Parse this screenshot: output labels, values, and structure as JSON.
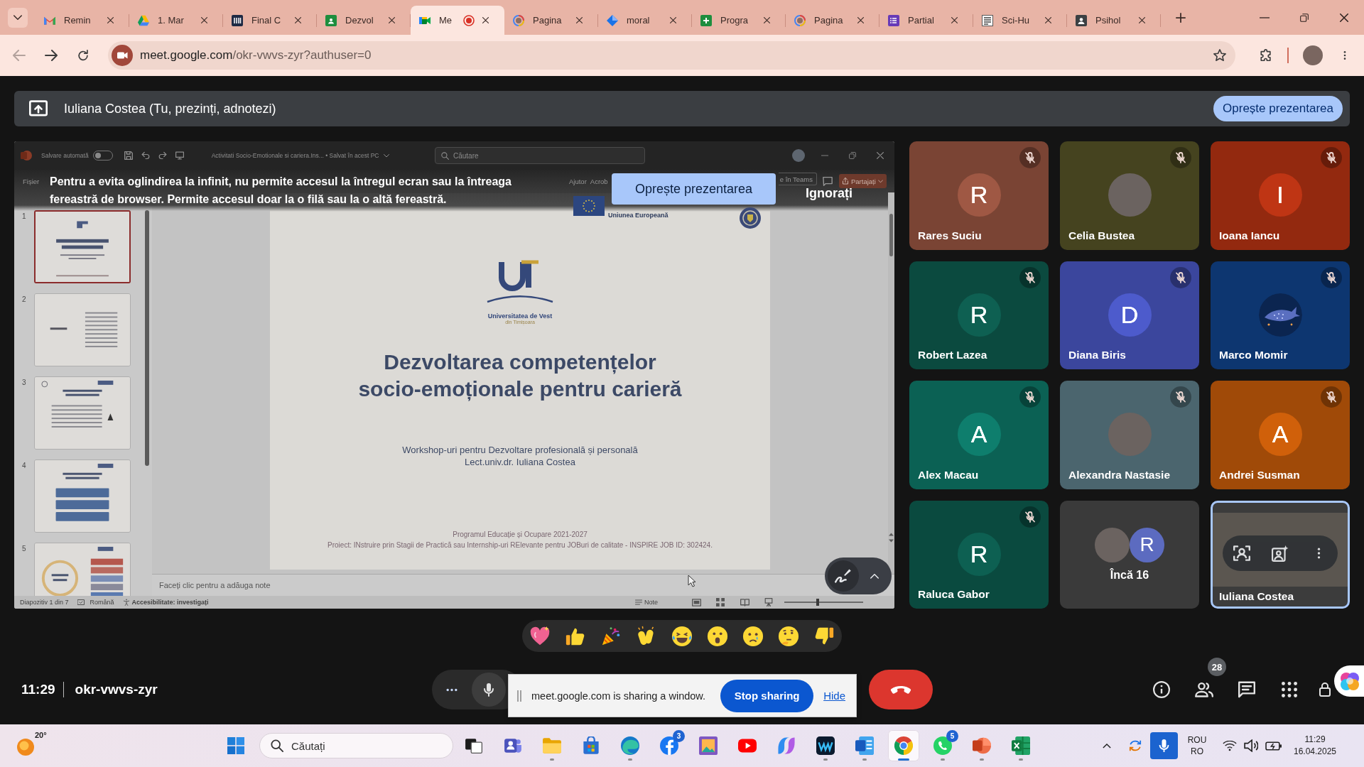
{
  "browser": {
    "tabs": [
      {
        "label": "Remin",
        "kind": "envelope",
        "selected": false,
        "recording": false
      },
      {
        "label": "1. Mar",
        "kind": "triangle",
        "selected": false,
        "recording": false
      },
      {
        "label": "Final C",
        "kind": "bars",
        "selected": false,
        "recording": false
      },
      {
        "label": "Dezvol",
        "kind": "person_board",
        "selected": false,
        "recording": false
      },
      {
        "label": "Me",
        "kind": "camera",
        "selected": true,
        "recording": true
      },
      {
        "label": "Pagina",
        "kind": "ring",
        "selected": false,
        "recording": false
      },
      {
        "label": "moral",
        "kind": "diamond",
        "selected": false,
        "recording": false
      },
      {
        "label": "Progra",
        "kind": "plus_square",
        "selected": false,
        "recording": false
      },
      {
        "label": "Pagina",
        "kind": "ring",
        "selected": false,
        "recording": false
      },
      {
        "label": "Partial",
        "kind": "list",
        "selected": false,
        "recording": false
      },
      {
        "label": "Sci-Hu",
        "kind": "document",
        "selected": false,
        "recording": false
      },
      {
        "label": "Psihol",
        "kind": "person_card",
        "selected": false,
        "recording": false
      }
    ],
    "back": {
      "disabled": true
    },
    "forward": {
      "disabled": false
    },
    "address": {
      "host": "meet.google.com",
      "path": "/okr-vwvs-zyr?authuser=0"
    }
  },
  "presenting_bar": {
    "label": "Iuliana Costea (Tu, prezinți, adnotezi)",
    "stop_button": "Oprește prezentarea"
  },
  "shared_window": {
    "warning": "Pentru a evita oglindirea la infinit, nu permite accesul la întregul ecran sau la întreaga fereastră de browser. Permite accesul doar la o filă sau la o altă fereastră.",
    "stop_button": "Oprește prezentarea",
    "dismiss_button": "Ignorați",
    "titlebar": {
      "autosave_label": "Salvare automată",
      "autosave_on": false,
      "document_title": "Activitati Socio-Emotionale si cariera.Ins... • Salvat în acest PC",
      "search": {
        "placeholder": "Căutare"
      }
    },
    "ribbon": {
      "tabs": [
        {
          "label": "Fișier"
        },
        {
          "label": "Ajutor"
        },
        {
          "label": "Acrob"
        }
      ],
      "teams_button": "e în Teams",
      "share_button": "Partajați"
    },
    "slides": [
      {
        "number": "1",
        "kind": "title",
        "selected": true
      },
      {
        "number": "2",
        "kind": "text",
        "selected": false
      },
      {
        "number": "3",
        "kind": "list",
        "selected": false
      },
      {
        "number": "4",
        "kind": "boxes",
        "selected": false
      },
      {
        "number": "5",
        "kind": "chart",
        "selected": false
      }
    ],
    "slide": {
      "eu_label": "Uniunea Europeană",
      "university": "Universitatea de Vest",
      "university_city": "din Timișoara",
      "title": "Dezvoltarea competențelor socio-emoționale pentru carieră",
      "subtitle": "Workshop-uri pentru Dezvoltare profesională și personală",
      "author": "Lect.univ.dr. Iuliana Costea",
      "programme": "Programul Educație și Ocupare 2021-2027",
      "project": "Proiect: INstruire prin Stagii de Practică sau Internship-uri RElevante pentru JOBuri de calitate - INSPIRE JOB ID: 302424."
    },
    "notes": {
      "placeholder": "Faceți clic pentru a adăuga note"
    },
    "status": {
      "slide_counter": "Diapozitiv 1 din 7",
      "language": "Română",
      "accessibility": "Accesibilitate: investigați",
      "notes_button": "Note",
      "zoom": {
        "level": 0.42
      }
    }
  },
  "tiles": [
    {
      "kind": "letter",
      "name": "Rares Suciu",
      "initial": "R",
      "color": "#7a4434",
      "muted": true,
      "selected": false
    },
    {
      "kind": "photo",
      "name": "Celia Bustea",
      "color": "#45431f",
      "muted": true,
      "selected": false
    },
    {
      "kind": "letter",
      "name": "Ioana Iancu",
      "initial": "I",
      "color": "#93290f",
      "muted": true,
      "selected": false
    },
    {
      "kind": "letter",
      "name": "Robert Lazea",
      "initial": "R",
      "color": "#0b4a3f",
      "muted": true,
      "selected": false
    },
    {
      "kind": "letter",
      "name": "Diana Biris",
      "initial": "D",
      "color": "#3b469d",
      "muted": true,
      "selected": false
    },
    {
      "kind": "picture",
      "name": "Marco Momir",
      "color": "#0d3670",
      "muted": true,
      "selected": false
    },
    {
      "kind": "letter",
      "name": "Alex Macau",
      "initial": "A",
      "color": "#0b6154",
      "muted": true,
      "selected": false
    },
    {
      "kind": "photo",
      "name": "Alexandra Nastasie",
      "color": "#4b656e",
      "muted": true,
      "selected": false
    },
    {
      "kind": "letter",
      "name": "Andrei Susman",
      "initial": "A",
      "color": "#a04a08",
      "muted": true,
      "selected": false
    },
    {
      "kind": "letter",
      "name": "Raluca Gabor",
      "initial": "R",
      "color": "#0a4a3f",
      "muted": true,
      "selected": false
    },
    {
      "kind": "overflow",
      "label": "Încă 16",
      "initial": "R",
      "color": "#5c6bc0",
      "muted": false,
      "selected": false
    },
    {
      "kind": "self",
      "name": "Iuliana Costea",
      "muted": false,
      "selected": true
    }
  ],
  "reactions": [
    {
      "kind": "heart"
    },
    {
      "kind": "thumbs_up"
    },
    {
      "kind": "party"
    },
    {
      "kind": "clap"
    },
    {
      "kind": "laugh"
    },
    {
      "kind": "surprised"
    },
    {
      "kind": "cry"
    },
    {
      "kind": "thinking"
    },
    {
      "kind": "thumbs_down"
    }
  ],
  "meeting": {
    "time": "11:29",
    "code": "okr-vwvs-zyr",
    "microphone_muted": false,
    "people_count": "28"
  },
  "share_notice": {
    "message": "meet.google.com is sharing a window.",
    "stop_button": "Stop sharing",
    "hide_link": "Hide"
  },
  "taskbar": {
    "weather": {
      "temperature": "20°"
    },
    "search": {
      "placeholder": "Căutați"
    },
    "apps": [
      {
        "kind": "task_view",
        "running": false,
        "selected": false
      },
      {
        "kind": "people_tile",
        "running": false,
        "selected": false
      },
      {
        "kind": "folder",
        "running": true,
        "selected": false
      },
      {
        "kind": "store",
        "running": false,
        "selected": false
      },
      {
        "kind": "wave_circle",
        "running": true,
        "selected": false
      },
      {
        "kind": "social",
        "badge": "3",
        "running": false,
        "selected": false
      },
      {
        "kind": "frame",
        "running": false,
        "selected": false
      },
      {
        "kind": "video",
        "running": false,
        "selected": false
      },
      {
        "kind": "loops",
        "running": false,
        "selected": false
      },
      {
        "kind": "zigzag",
        "running": true,
        "selected": false
      },
      {
        "kind": "document",
        "running": true,
        "selected": false
      },
      {
        "kind": "browser",
        "running": true,
        "selected": true
      },
      {
        "kind": "messenger",
        "badge": "5",
        "running": true,
        "selected": false
      },
      {
        "kind": "slides",
        "running": true,
        "selected": false
      },
      {
        "kind": "spreadsheet",
        "running": true,
        "selected": false
      }
    ],
    "tray": {
      "mic_in_use": true,
      "language": "ROU",
      "layout": "RO",
      "time": "11:29",
      "date": "16.04.2025"
    }
  }
}
